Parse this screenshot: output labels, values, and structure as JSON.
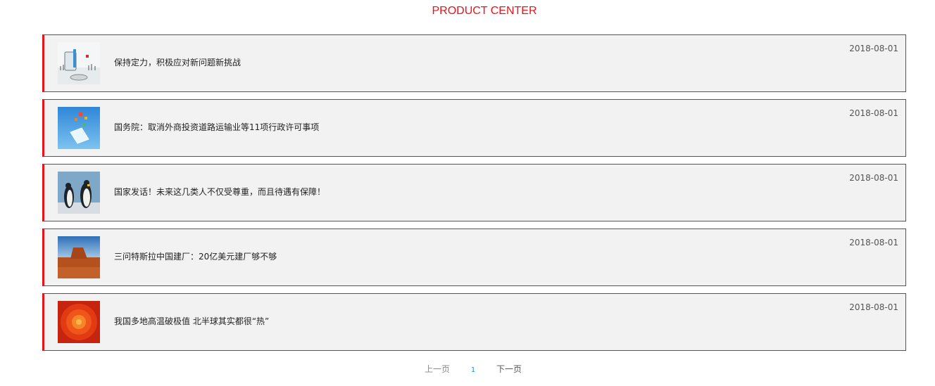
{
  "header": {
    "title": "PRODUCT CENTER"
  },
  "news": [
    {
      "title": "保持定力，积极应对新问题新挑战",
      "date": "2018-08-01",
      "thumb_icon": "vr-device-image"
    },
    {
      "title": "国务院：取消外商投资道路运输业等11项行政许可事项",
      "date": "2018-08-01",
      "thumb_icon": "phone-illustration-image"
    },
    {
      "title": "国家发话！未来这几类人不仅受尊重，而且待遇有保障！",
      "date": "2018-08-01",
      "thumb_icon": "penguins-image"
    },
    {
      "title": "三问特斯拉中国建厂：20亿美元建厂够不够",
      "date": "2018-08-01",
      "thumb_icon": "desert-image"
    },
    {
      "title": "我国多地高温破极值 北半球其实都很“热”",
      "date": "2018-08-01",
      "thumb_icon": "chrysanthemum-image"
    }
  ],
  "pagination": {
    "prev": "上一页",
    "current": "1",
    "next": "下一页"
  },
  "colors": {
    "accent": "#e8141a",
    "item_bg": "#f2f2f2",
    "page_link": "#2a8ad8"
  }
}
